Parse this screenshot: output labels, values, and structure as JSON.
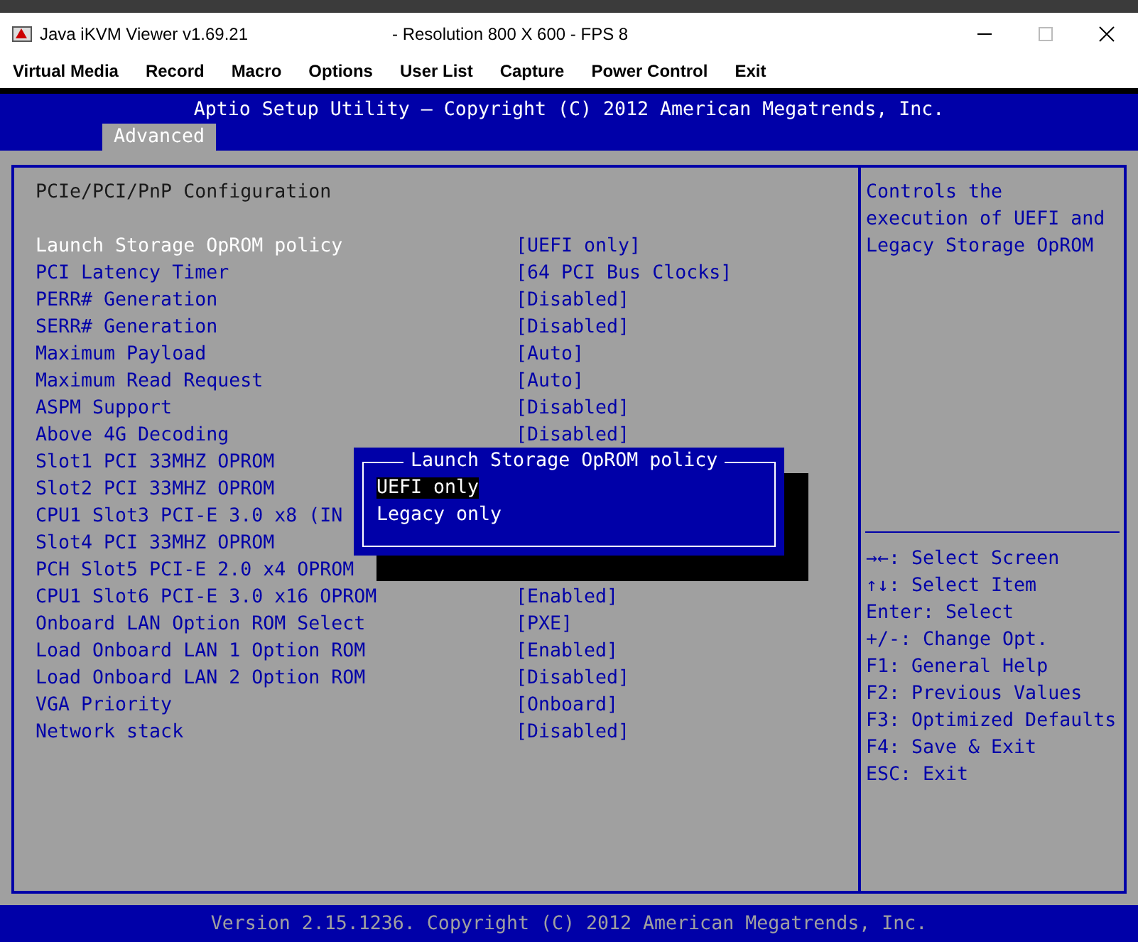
{
  "window": {
    "title": "Java iKVM Viewer v1.69.21",
    "subtitle": "- Resolution 800 X 600 - FPS 8"
  },
  "menu": [
    "Virtual Media",
    "Record",
    "Macro",
    "Options",
    "User List",
    "Capture",
    "Power Control",
    "Exit"
  ],
  "bios": {
    "header": "Aptio Setup Utility – Copyright (C) 2012 American Megatrends, Inc.",
    "tabs": [
      {
        "label": "Advanced",
        "selected": true
      }
    ],
    "section_title": "PCIe/PCI/PnP Configuration",
    "settings": [
      {
        "label": "Launch Storage OpROM policy",
        "value": "[UEFI only]",
        "selected": true
      },
      {
        "label": "PCI Latency Timer",
        "value": "[64 PCI Bus Clocks]",
        "selected": false
      },
      {
        "label": "PERR# Generation",
        "value": "[Disabled]",
        "selected": false
      },
      {
        "label": "SERR# Generation",
        "value": "[Disabled]",
        "selected": false
      },
      {
        "label": "Maximum Payload",
        "value": "[Auto]",
        "selected": false
      },
      {
        "label": "Maximum Read Request",
        "value": "[Auto]",
        "selected": false
      },
      {
        "label": "ASPM Support",
        "value": "[Disabled]",
        "selected": false
      },
      {
        "label": "Above 4G Decoding",
        "value": "[Disabled]",
        "selected": false
      },
      {
        "label": "Slot1 PCI 33MHZ OPROM",
        "selected": false
      },
      {
        "label": "Slot2 PCI 33MHZ OPROM",
        "selected": false
      },
      {
        "label": "CPU1 Slot3 PCI-E 3.0 x8 (IN",
        "selected": false
      },
      {
        "label": "Slot4 PCI 33MHZ OPROM",
        "selected": false
      },
      {
        "label": "PCH Slot5 PCI-E 2.0 x4 OPROM",
        "selected": false
      },
      {
        "label": "CPU1 Slot6 PCI-E 3.0 x16 OPROM",
        "value": "[Enabled]",
        "selected": false
      },
      {
        "label": "Onboard LAN Option ROM Select",
        "value": "[PXE]",
        "selected": false
      },
      {
        "label": "Load Onboard LAN 1 Option ROM",
        "value": "[Enabled]",
        "selected": false
      },
      {
        "label": "Load Onboard LAN 2 Option ROM",
        "value": "[Disabled]",
        "selected": false
      },
      {
        "label": "VGA Priority",
        "value": "[Onboard]",
        "selected": false
      },
      {
        "label": "Network stack",
        "value": "[Disabled]",
        "selected": false
      }
    ],
    "help_text": "Controls the execution of UEFI and Legacy Storage OpROM",
    "key_help": [
      "→←: Select Screen",
      "↑↓: Select Item",
      "Enter: Select",
      "+/-: Change Opt.",
      "F1: General Help",
      "F2: Previous Values",
      "F3: Optimized Defaults",
      "F4: Save & Exit",
      "ESC: Exit"
    ],
    "footer": "Version 2.15.1236. Copyright (C) 2012 American Megatrends, Inc."
  },
  "popup": {
    "title": "Launch Storage OpROM policy",
    "options": [
      {
        "label": "UEFI only",
        "selected": true
      },
      {
        "label": "Legacy only",
        "selected": false
      }
    ]
  }
}
